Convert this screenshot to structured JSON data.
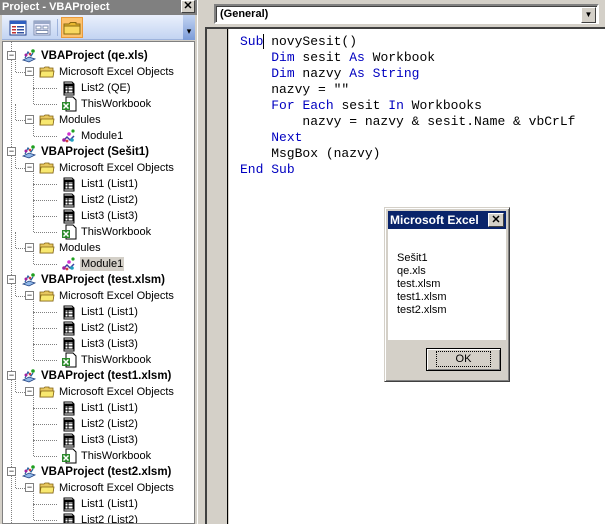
{
  "project_pane": {
    "title": "Project - VBAProject",
    "close_glyph": "✕",
    "toolbar": {
      "view_code": "view-code-icon",
      "view_object": "view-object-icon",
      "toggle_folders": "toggle-folders-icon",
      "overflow_glyph": "▾"
    },
    "tree": [
      {
        "level": 0,
        "label": "VBAProject (qe.xls)",
        "icon": "vbaproject",
        "expander": "−",
        "bold": true
      },
      {
        "level": 1,
        "label": "Microsoft Excel Objects",
        "icon": "folder",
        "expander": "−"
      },
      {
        "level": 2,
        "label": "List2 (QE)",
        "icon": "sheet"
      },
      {
        "level": 2,
        "label": "ThisWorkbook",
        "icon": "workbook"
      },
      {
        "level": 1,
        "label": "Modules",
        "icon": "folder",
        "expander": "−"
      },
      {
        "level": 2,
        "label": "Module1",
        "icon": "module"
      },
      {
        "level": 0,
        "label": "VBAProject (Sešit1)",
        "icon": "vbaproject",
        "expander": "−",
        "bold": true
      },
      {
        "level": 1,
        "label": "Microsoft Excel Objects",
        "icon": "folder",
        "expander": "−"
      },
      {
        "level": 2,
        "label": "List1 (List1)",
        "icon": "sheet"
      },
      {
        "level": 2,
        "label": "List2 (List2)",
        "icon": "sheet"
      },
      {
        "level": 2,
        "label": "List3 (List3)",
        "icon": "sheet"
      },
      {
        "level": 2,
        "label": "ThisWorkbook",
        "icon": "workbook"
      },
      {
        "level": 1,
        "label": "Modules",
        "icon": "folder",
        "expander": "−"
      },
      {
        "level": 2,
        "label": "Module1",
        "icon": "module",
        "selected": true
      },
      {
        "level": 0,
        "label": "VBAProject (test.xlsm)",
        "icon": "vbaproject",
        "expander": "−",
        "bold": true
      },
      {
        "level": 1,
        "label": "Microsoft Excel Objects",
        "icon": "folder",
        "expander": "−"
      },
      {
        "level": 2,
        "label": "List1 (List1)",
        "icon": "sheet"
      },
      {
        "level": 2,
        "label": "List2 (List2)",
        "icon": "sheet"
      },
      {
        "level": 2,
        "label": "List3 (List3)",
        "icon": "sheet"
      },
      {
        "level": 2,
        "label": "ThisWorkbook",
        "icon": "workbook"
      },
      {
        "level": 0,
        "label": "VBAProject (test1.xlsm)",
        "icon": "vbaproject",
        "expander": "−",
        "bold": true
      },
      {
        "level": 1,
        "label": "Microsoft Excel Objects",
        "icon": "folder",
        "expander": "−"
      },
      {
        "level": 2,
        "label": "List1 (List1)",
        "icon": "sheet"
      },
      {
        "level": 2,
        "label": "List2 (List2)",
        "icon": "sheet"
      },
      {
        "level": 2,
        "label": "List3 (List3)",
        "icon": "sheet"
      },
      {
        "level": 2,
        "label": "ThisWorkbook",
        "icon": "workbook"
      },
      {
        "level": 0,
        "label": "VBAProject (test2.xlsm)",
        "icon": "vbaproject",
        "expander": "−",
        "bold": true
      },
      {
        "level": 1,
        "label": "Microsoft Excel Objects",
        "icon": "folder",
        "expander": "−"
      },
      {
        "level": 2,
        "label": "List1 (List1)",
        "icon": "sheet"
      },
      {
        "level": 2,
        "label": "List2 (List2)",
        "icon": "sheet"
      }
    ]
  },
  "code_window": {
    "object_combo_value": "(General)",
    "combo_arrow": "▼",
    "lines": [
      [
        {
          "t": "Sub",
          "kw": true
        },
        {
          "t": " novySesit()"
        }
      ],
      [
        {
          "t": "    "
        },
        {
          "t": "Dim",
          "kw": true
        },
        {
          "t": " sesit "
        },
        {
          "t": "As",
          "kw": true
        },
        {
          "t": " Workbook"
        }
      ],
      [
        {
          "t": "    "
        },
        {
          "t": "Dim",
          "kw": true
        },
        {
          "t": " nazvy "
        },
        {
          "t": "As",
          "kw": true
        },
        {
          "t": " "
        },
        {
          "t": "String",
          "kw": true
        }
      ],
      [
        {
          "t": "    nazvy = \"\""
        }
      ],
      [
        {
          "t": "    "
        },
        {
          "t": "For",
          "kw": true
        },
        {
          "t": " "
        },
        {
          "t": "Each",
          "kw": true
        },
        {
          "t": " sesit "
        },
        {
          "t": "In",
          "kw": true
        },
        {
          "t": " Workbooks"
        }
      ],
      [
        {
          "t": "        nazvy = nazvy & sesit.Name & vbCrLf"
        }
      ],
      [
        {
          "t": "    "
        },
        {
          "t": "Next",
          "kw": true
        }
      ],
      [
        {
          "t": "    MsgBox (nazvy)"
        }
      ],
      [
        {
          "t": "End",
          "kw": true
        },
        {
          "t": " "
        },
        {
          "t": "Sub",
          "kw": true
        }
      ]
    ],
    "keyword_color": "#0000c0"
  },
  "msgbox": {
    "title": "Microsoft Excel",
    "close_glyph": "✕",
    "message": "Sešit1\nqe.xls\ntest.xlsm\ntest1.xlsm\ntest2.xlsm",
    "ok_label": "OK",
    "title_color": "#0a246a"
  }
}
